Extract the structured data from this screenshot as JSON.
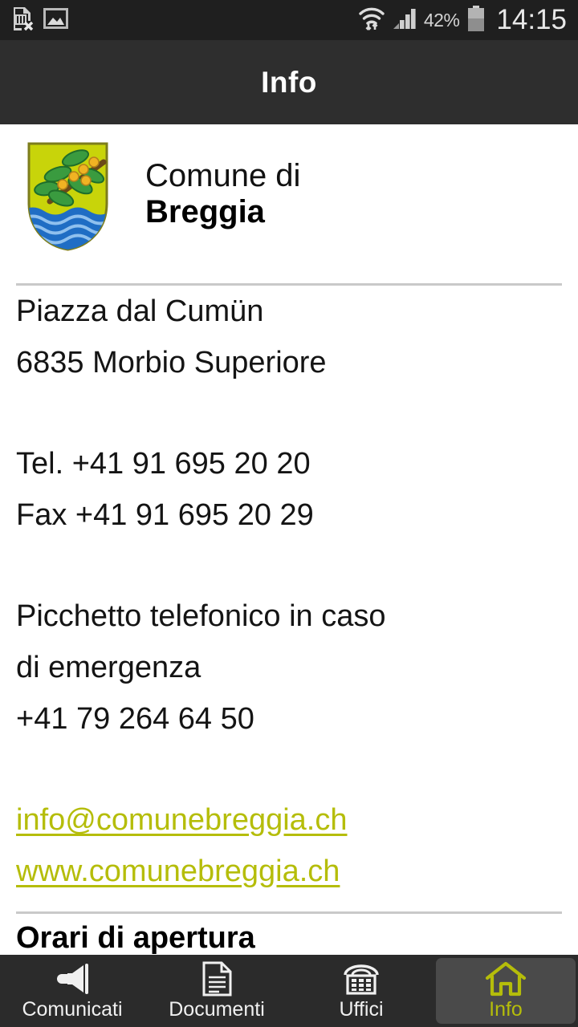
{
  "statusbar": {
    "left_icons": [
      "sim-card-error-icon",
      "image-icon"
    ],
    "wifi_icon": "wifi-transfer-icon",
    "signal_icon": "cellular-signal-icon",
    "battery_percent": "42%",
    "battery_icon": "battery-icon",
    "clock": "14:15"
  },
  "titlebar": {
    "title": "Info"
  },
  "brand": {
    "crest_icon": "breggia-coat-of-arms",
    "line1": "Comune di",
    "line2": "Breggia",
    "colors": {
      "shield": "#c8d40a",
      "leaf": "#3a9b3f",
      "berry": "#f0b323",
      "branch": "#6b4a18",
      "water": "#1f6dc4"
    }
  },
  "info": {
    "address_street": "Piazza dal Cumün",
    "address_city": "6835 Morbio Superiore",
    "tel": "Tel. +41 91 695 20 20",
    "fax": "Fax +41 91 695 20 29",
    "emergency_line1": "Picchetto telefonico in caso",
    "emergency_line2": "di emergenza",
    "emergency_number": "+41 79 264 64 50",
    "email": "info@comunebreggia.ch",
    "website": "www.comunebreggia.ch",
    "link_color": "#b5bd0a",
    "next_section": "Orari di apertura"
  },
  "navbar": {
    "items": [
      {
        "label": "Comunicati",
        "icon": "megaphone-icon",
        "active": false
      },
      {
        "label": "Documenti",
        "icon": "document-icon",
        "active": false
      },
      {
        "label": "Uffici",
        "icon": "telephone-icon",
        "active": false
      },
      {
        "label": "Info",
        "icon": "home-icon",
        "active": true
      }
    ],
    "active_color": "#b5bd0a"
  }
}
